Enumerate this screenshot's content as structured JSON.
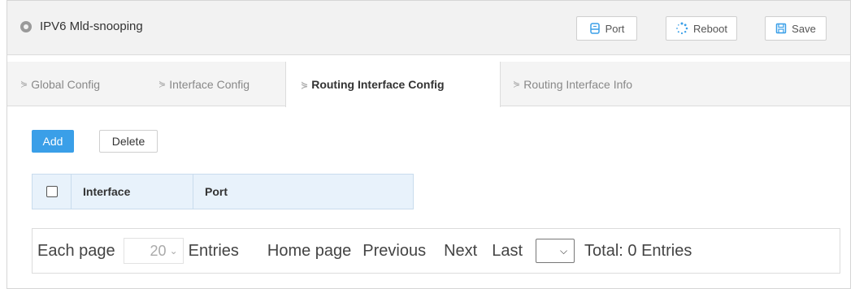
{
  "header": {
    "title": "IPV6 Mld-snooping",
    "buttons": {
      "port": "Port",
      "reboot": "Reboot",
      "save": "Save"
    }
  },
  "tabs": [
    {
      "label": "Global Config",
      "active": false
    },
    {
      "label": "Interface Config",
      "active": false
    },
    {
      "label": "Routing Interface Config",
      "active": true
    },
    {
      "label": "Routing Interface Info",
      "active": false
    }
  ],
  "actions": {
    "add": "Add",
    "delete": "Delete"
  },
  "table": {
    "columns": [
      "Interface",
      "Port"
    ],
    "rows": []
  },
  "pager": {
    "each_page": "Each page",
    "page_size": "20",
    "entries": "Entries",
    "home": "Home page",
    "previous": "Previous",
    "next": "Next",
    "last": "Last",
    "page_select": "",
    "total": "Total: 0 Entries"
  },
  "colors": {
    "accent": "#3a9fe8",
    "header_bg": "#f2f2f2",
    "table_header_bg": "#e8f2fb"
  }
}
